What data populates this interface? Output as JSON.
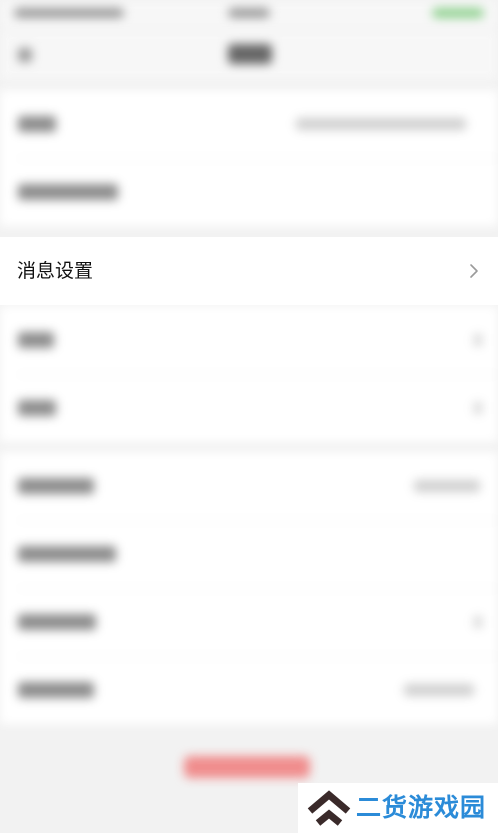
{
  "message_settings": {
    "label": "消息设置",
    "chevron_icon": "chevron-right-icon"
  },
  "watermark": {
    "text": "二货游戏园",
    "logo_icon": "double-chevron-up-logo-icon"
  },
  "colors": {
    "background": "#f2f2f2",
    "card": "#ffffff",
    "watermark_blue": "#2b8bd8",
    "logo_dark": "#3a2a2a",
    "logout_red": "#f08c8c"
  }
}
